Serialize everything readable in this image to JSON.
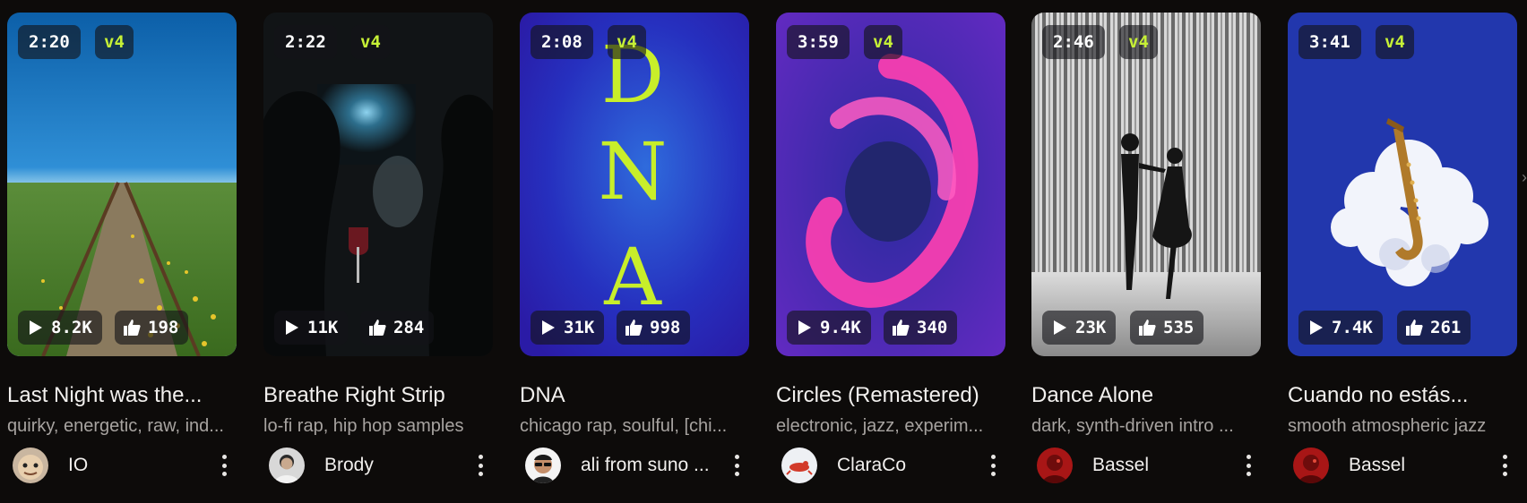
{
  "cards": [
    {
      "duration": "2:20",
      "version": "v4",
      "plays": "8.2K",
      "likes": "198",
      "title": "Last Night was the...",
      "tags": "quirky, energetic, raw, ind...",
      "author": "IO",
      "cover_icon": "railroad-field-image",
      "avatar_icon": "cartoon-face-avatar"
    },
    {
      "duration": "2:22",
      "version": "v4",
      "plays": "11K",
      "likes": "284",
      "title": "Breathe Right Strip",
      "tags": "lo-fi rap, hip hop samples",
      "author": "Brody",
      "cover_icon": "smoky-room-image",
      "avatar_icon": "person-photo-avatar"
    },
    {
      "duration": "2:08",
      "version": "v4",
      "plays": "31K",
      "likes": "998",
      "title": "DNA",
      "tags": "chicago rap, soulful, [chi...",
      "author": "ali from suno ...",
      "cover_icon": "dna-typography-image",
      "cover_letters": [
        "D",
        "N",
        "A"
      ],
      "avatar_icon": "sunglasses-person-avatar"
    },
    {
      "duration": "3:59",
      "version": "v4",
      "plays": "9.4K",
      "likes": "340",
      "title": "Circles (Remastered)",
      "tags": "electronic, jazz, experim...",
      "author": "ClaraCo",
      "cover_icon": "pink-swirl-image",
      "avatar_icon": "red-figure-avatar"
    },
    {
      "duration": "2:46",
      "version": "v4",
      "plays": "23K",
      "likes": "535",
      "title": "Dance Alone",
      "tags": "dark, synth-driven intro ...",
      "author": "Bassel",
      "cover_icon": "dancing-couple-image",
      "avatar_icon": "red-portrait-avatar"
    },
    {
      "duration": "3:41",
      "version": "v4",
      "plays": "7.4K",
      "likes": "261",
      "title": "Cuando no estás...",
      "tags": "smooth atmospheric jazz",
      "author": "Bassel",
      "cover_icon": "saxophone-cloud-image",
      "avatar_icon": "red-portrait-avatar"
    }
  ],
  "colors": {
    "background": "#0d0b0a",
    "version_accent": "#c6f036",
    "dna_letters": "#c8ee2a"
  }
}
